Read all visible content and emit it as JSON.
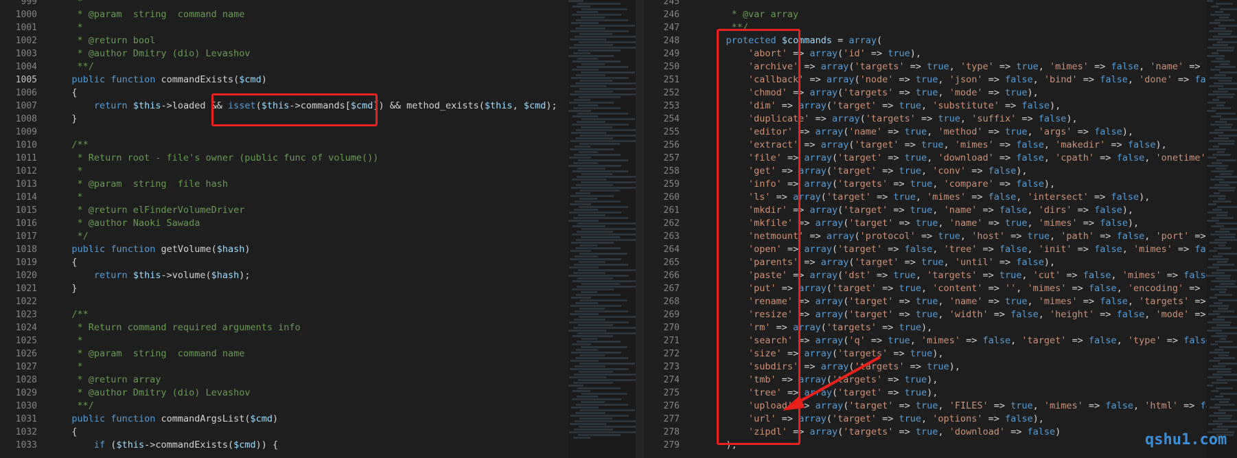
{
  "left_editor": {
    "line_numbers": [
      "999",
      "1000",
      "1001",
      "1002",
      "1003",
      "1004",
      "1005",
      "1006",
      "1007",
      "1008",
      "1009",
      "1010",
      "1011",
      "1012",
      "1013",
      "1014",
      "1015",
      "1016",
      "1017",
      "1018",
      "1019",
      "1020",
      "1021",
      "1022",
      "1023",
      "1024",
      "1025",
      "1026",
      "1027",
      "1028",
      "1029",
      "1030",
      "1031",
      "1032",
      "1033"
    ],
    "active_line": "1005",
    "lines": [
      "    *",
      "    * @param  string  command name",
      "    *",
      "    * @return bool",
      "    * @author Dmitry (dio) Levashov",
      "    **/",
      "   public function commandExists($cmd)",
      "   {",
      "       return $this->loaded && isset($this->commands[$cmd]) && method_exists($this, $cmd);",
      "   }",
      "",
      "   /**",
      "    * Return root - file's owner (public func of volume())",
      "    *",
      "    * @param  string  file hash",
      "    *",
      "    * @return elFinderVolumeDriver",
      "    * @author Naoki Sawada",
      "    */",
      "   public function getVolume($hash)",
      "   {",
      "       return $this->volume($hash);",
      "   }",
      "",
      "   /**",
      "    * Return command required arguments info",
      "    *",
      "    * @param  string  command name",
      "    *",
      "    * @return array",
      "    * @author Dmitry (dio) Levashov",
      "    **/",
      "   public function commandArgsList($cmd)",
      "   {",
      "       if ($this->commandExists($cmd)) {"
    ]
  },
  "right_editor": {
    "line_numbers": [
      "245",
      "246",
      "247",
      "248",
      "249",
      "250",
      "251",
      "252",
      "253",
      "254",
      "255",
      "256",
      "257",
      "258",
      "259",
      "260",
      "261",
      "262",
      "263",
      "264",
      "265",
      "266",
      "267",
      "268",
      "269",
      "270",
      "271",
      "272",
      "273",
      "274",
      "275",
      "276",
      "277",
      "278",
      "279"
    ],
    "lines": [
      "",
      "     * @var array",
      "     **/",
      "    protected $commands = array(",
      "        'abort' => array('id' => true),",
      "        'archive' => array('targets' => true, 'type' => true, 'mimes' => false, 'name' => false),",
      "        'callback' => array('node' => true, 'json' => false, 'bind' => false, 'done' => false),",
      "        'chmod' => array('targets' => true, 'mode' => true),",
      "        'dim' => array('target' => true, 'substitute' => false),",
      "        'duplicate' => array('targets' => true, 'suffix' => false),",
      "        'editor' => array('name' => true, 'method' => true, 'args' => false),",
      "        'extract' => array('target' => true, 'mimes' => false, 'makedir' => false),",
      "        'file' => array('target' => true, 'download' => false, 'cpath' => false, 'onetime' => fa",
      "        'get' => array('target' => true, 'conv' => false),",
      "        'info' => array('targets' => true, 'compare' => false),",
      "        'ls' => array('target' => true, 'mimes' => false, 'intersect' => false),",
      "        'mkdir' => array('target' => true, 'name' => false, 'dirs' => false),",
      "        'mkfile' => array('target' => true, 'name' => true, 'mimes' => false),",
      "        'netmount' => array('protocol' => true, 'host' => true, 'path' => false, 'port' => false",
      "        'open' => array('target' => false, 'tree' => false, 'init' => false, 'mimes' => false, '",
      "        'parents' => array('target' => true, 'until' => false),",
      "        'paste' => array('dst' => true, 'targets' => true, 'cut' => false, 'mimes' => false, 're",
      "        'put' => array('target' => true, 'content' => '', 'mimes' => false, 'encoding' => false)",
      "        'rename' => array('target' => true, 'name' => true, 'mimes' => false, 'targets' => false",
      "        'resize' => array('target' => true, 'width' => false, 'height' => false, 'mode' => false",
      "        'rm' => array('targets' => true),",
      "        'search' => array('q' => true, 'mimes' => false, 'target' => false, 'type' => false),",
      "        'size' => array('targets' => true),",
      "        'subdirs' => array('targets' => true),",
      "        'tmb' => array('targets' => true),",
      "        'tree' => array('target' => true),",
      "        'upload' => array('target' => true, 'FILES' => true, 'mimes' => false, 'html' => false,",
      "        'url' => array('target' => true, 'options' => false),",
      "        'zipdl' => array('targets' => true, 'download' => false)",
      "    );"
    ]
  },
  "watermark": "qshu1.com",
  "colors": {
    "background": "#1e1e1e",
    "annotation_red": "#e8211d",
    "watermark_blue": "#3a8fd8"
  }
}
